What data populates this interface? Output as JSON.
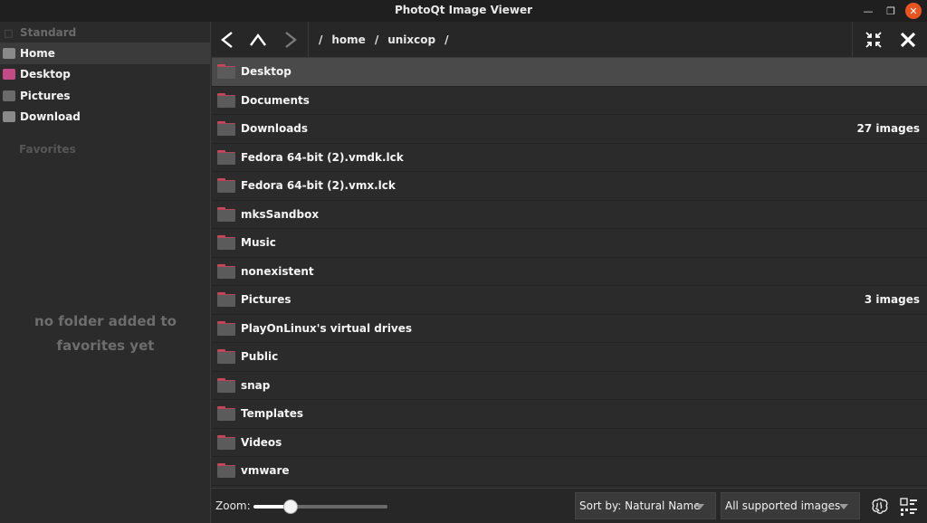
{
  "window": {
    "title": "PhotoQt Image Viewer",
    "min_icon": "minimize-icon",
    "max_icon": "maximize-icon",
    "close_icon": "close-icon"
  },
  "sidebar": {
    "standard_label": "Standard",
    "items": [
      {
        "label": "Home",
        "color": "#8a8a8a"
      },
      {
        "label": "Desktop",
        "color": "#c24a86"
      },
      {
        "label": "Pictures",
        "color": "#6b6b6b"
      },
      {
        "label": "Download",
        "color": "#8a8a8a"
      }
    ],
    "favorites_label": "Favorites",
    "favorites_empty": "no folder added to favorites yet"
  },
  "nav": {
    "back_icon": "back-arrow-icon",
    "up_icon": "up-arrow-icon",
    "forward_icon": "forward-arrow-icon",
    "breadcrumb": {
      "root": "/",
      "parts": [
        "home",
        "unixcop"
      ],
      "sep": "/"
    },
    "fullscreen_icon": "collapse-icon",
    "close_icon": "close-icon"
  },
  "files": [
    {
      "name": "Desktop",
      "count": ""
    },
    {
      "name": "Documents",
      "count": ""
    },
    {
      "name": "Downloads",
      "count": "27 images"
    },
    {
      "name": "Fedora 64-bit (2).vmdk.lck",
      "count": ""
    },
    {
      "name": "Fedora 64-bit (2).vmx.lck",
      "count": ""
    },
    {
      "name": "mksSandbox",
      "count": ""
    },
    {
      "name": "Music",
      "count": ""
    },
    {
      "name": "nonexistent",
      "count": ""
    },
    {
      "name": "Pictures",
      "count": "3 images"
    },
    {
      "name": "PlayOnLinux's virtual drives",
      "count": ""
    },
    {
      "name": "Public",
      "count": ""
    },
    {
      "name": "snap",
      "count": ""
    },
    {
      "name": "Templates",
      "count": ""
    },
    {
      "name": "Videos",
      "count": ""
    },
    {
      "name": "vmware",
      "count": ""
    }
  ],
  "bottom": {
    "zoom_label": "Zoom:",
    "zoom_level": 0.28,
    "sort_label": "Sort by: Natural Name",
    "filter_label": "All supported images",
    "remember_icon": "brain-icon",
    "view_icon": "view-mode-icon"
  },
  "colors": {
    "accent_close": "#e95420",
    "folder_tab": "#c8465a",
    "folder_body": "#5b5b5b"
  }
}
